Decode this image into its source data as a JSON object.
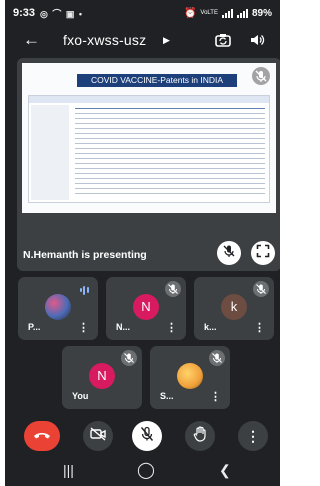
{
  "status_bar": {
    "time": "9:33",
    "left_icons": "◎ ⌒ ▣ •",
    "network": "VoLTE",
    "battery": "89%"
  },
  "meeting": {
    "code": "fxo-xwss-usz"
  },
  "presentation": {
    "slide_title": "COVID VACCINE-Patents in INDIA",
    "presenter_label": "N.Hemanth is presenting"
  },
  "participants": [
    {
      "initial": "",
      "name": "P...",
      "avatar_color": "#6d4c8f",
      "speaking": true
    },
    {
      "initial": "N",
      "name": "N...",
      "avatar_color": "#d81b60",
      "speaking": false
    },
    {
      "initial": "k",
      "name": "k...",
      "avatar_color": "#6d4c41",
      "speaking": false
    },
    {
      "initial": "N",
      "name": "You",
      "avatar_color": "#d81b60",
      "speaking": false
    },
    {
      "initial": "",
      "name": "S...",
      "avatar_color": "#f1a03a",
      "speaking": false
    }
  ],
  "colors": {
    "background": "#202124",
    "tile": "#3c4043",
    "end_call": "#ea4335",
    "speaking": "#8ab4f8"
  },
  "icons": {
    "back": "arrow-back-icon",
    "camera_switch": "camera-switch-icon",
    "audio": "speaker-icon",
    "end_call": "end-call-icon",
    "camera_off": "camera-off-icon",
    "mic_off": "mic-off-icon",
    "raise_hand": "raise-hand-icon",
    "more": "more-options-icon"
  }
}
